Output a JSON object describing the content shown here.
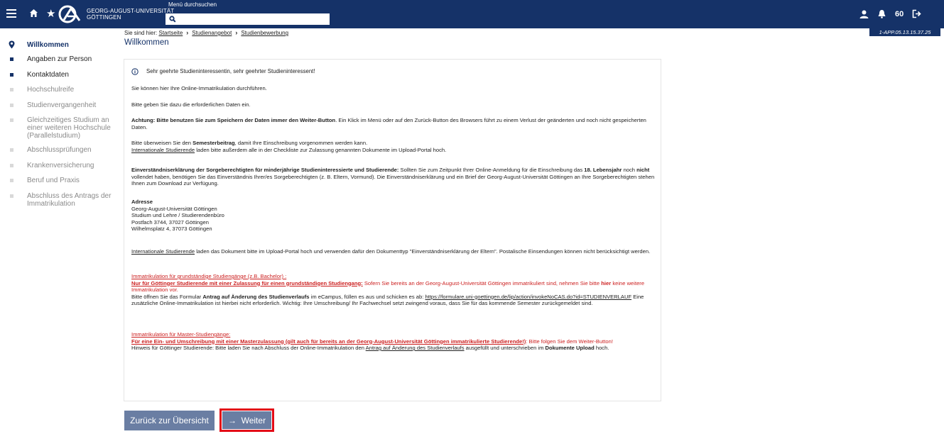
{
  "header": {
    "logo_line1": "GEORG-AUGUST-UNIVERSITÄT",
    "logo_line2": "GÖTTINGEN",
    "menu_search_label": "Menü durchsuchen",
    "badge_count": "60",
    "server_id": "1-APP.05.13.15.37.25",
    "colors": {
      "bar": "#153268"
    }
  },
  "breadcrumb": {
    "prefix": "Sie sind hier:",
    "items": [
      "Startseite",
      "Studienangebot",
      "Studienbewerbung"
    ]
  },
  "page_title": "Willkommen",
  "sidebar": {
    "items": [
      {
        "label": "Willkommen",
        "state": "active"
      },
      {
        "label": "Angaben zur Person",
        "state": "done"
      },
      {
        "label": "Kontaktdaten",
        "state": "done"
      },
      {
        "label": "Hochschulreife",
        "state": "open"
      },
      {
        "label": "Studienvergangenheit",
        "state": "open"
      },
      {
        "label": "Gleichzeitiges Studium an einer weiteren Hochschule (Parallelstudium)",
        "state": "open"
      },
      {
        "label": "Abschlussprüfungen",
        "state": "open"
      },
      {
        "label": "Krankenversicherung",
        "state": "open"
      },
      {
        "label": "Beruf und Praxis",
        "state": "open"
      },
      {
        "label": "Abschluss des Antrags der Immatrikulation",
        "state": "open"
      }
    ]
  },
  "content": {
    "greeting": "Sehr geehrte Studieninteressentin, sehr geehrter Studieninteressent!",
    "intro": "Sie können hier Ihre Online-Immatrikulation durchführen.",
    "data_hint": "Bitte geben Sie dazu die erforderlichen Daten ein.",
    "warning_bold": "Achtung: Bitte benutzen Sie zum Speichern der Daten immer den Weiter-Button",
    "warning_rest": ". Ein Klick im Menü oder auf den Zurück-Button des Browsers führt zu einem Verlust der geänderten und noch nicht gespeicherten Daten.",
    "fee_a": "Bitte überweisen Sie den ",
    "fee_bold": "Semesterbeitrag",
    "fee_b": ", damit Ihre Einschreibung vorgenommen werden kann.",
    "intl_link": "Internationale Studierende",
    "intl_rest": " laden bitte außerdem alle in der Checkliste zur Zulassung genannten Dokumente im Upload-Portal hoch.",
    "consent_bold": "Einverständniserklärung der Sorgeberechtigten für minderjährige Studieninteressierte und Studierende:",
    "consent_a": " Sollten Sie zum Zeitpunkt Ihrer Online-Anmeldung für die Einschreibung das ",
    "consent_b1": "18. Lebensjahr",
    "consent_c": " noch ",
    "consent_b2": "nicht",
    "consent_d": " vollendet haben, benötigen Sie das Einverständnis Ihrer/es Sorgeberechtigten (z. B. Eltern, Vormund). Die Einverständniserklärung und ein Brief der Georg-August-Universität Göttingen an Ihre Sorgeberechtigten stehen Ihnen zum Download zur Verfügung.",
    "address_title": "Adresse",
    "address_lines": [
      "Georg-August-Universität Göttingen",
      "Studium und Lehre / Studierendenbüro",
      "Postfach 3744, 37027 Göttingen",
      "Wilhelmsplatz 4, 37073 Göttingen"
    ],
    "intl2_link": "Internationale Studierende",
    "intl2_rest": " laden das Dokument bitte im Upload-Portal hoch und verwenden dafür den Dokumenttyp \"Einverständniserklärung der Eltern\". Postalische Einsendungen können nicht berücksichtigt werden.",
    "bachelor_heading": "Immatrikulation für grundständige Studiengänge (z.B. Bachelor) :",
    "bachelor_bold": "Nur für Göttinger Studierende mit einer Zulassung für einen grundständigen Studiengang:",
    "bachelor_red_a": " Sofern Sie bereits an der Georg-August-Universität Göttingen immatrikuliert sind, nehmen Sie bitte ",
    "bachelor_red_bold": "hier",
    "bachelor_red_b": " keine weitere Immatrikulation vor.",
    "bachelor_form_a": "Bitte öffnen Sie das Formular ",
    "bachelor_form_bold": "Antrag auf Änderung des Studienverlaufs",
    "bachelor_form_b": " im eCampus, füllen es aus und schicken es ab: ",
    "bachelor_url": "https://formulare.uni-goettingen.de/lip/action/invokeNoCAS.do?id=STUDIENVERLAUF",
    "bachelor_form_c": " Eine zusätzliche Online-Immatrikulation ist hierbei nicht erforderlich. Wichtig: Ihre Umschreibung/ Ihr Fachwechsel setzt zwingend voraus, dass Sie für das kommende Semester zurückgemeldet sind.",
    "master_heading": "Immatrikulation für Master-Studiengänge:",
    "master_bold": "Für eine Ein- und Umschreibung mit einer Masterzulassung (gilt auch für bereits an der Georg-August-Universität Göttingen immatrikulierte Studierende!)",
    "master_red": ": Bitte folgen Sie dem Weiter-Button!",
    "master_hint_a": "Hinweis für Göttinger Studierende: Bitte laden Sie nach Abschluss der Online-Immatrikulation den ",
    "master_hint_link": "Antrag auf Änderung des Studienverlaufs",
    "master_hint_b": " ausgefüllt und unterschrieben im ",
    "master_hint_bold": "Dokumente Upload",
    "master_hint_c": " hoch."
  },
  "buttons": {
    "back_label": "Zurück zur Übersicht",
    "next_label": "Weiter"
  }
}
